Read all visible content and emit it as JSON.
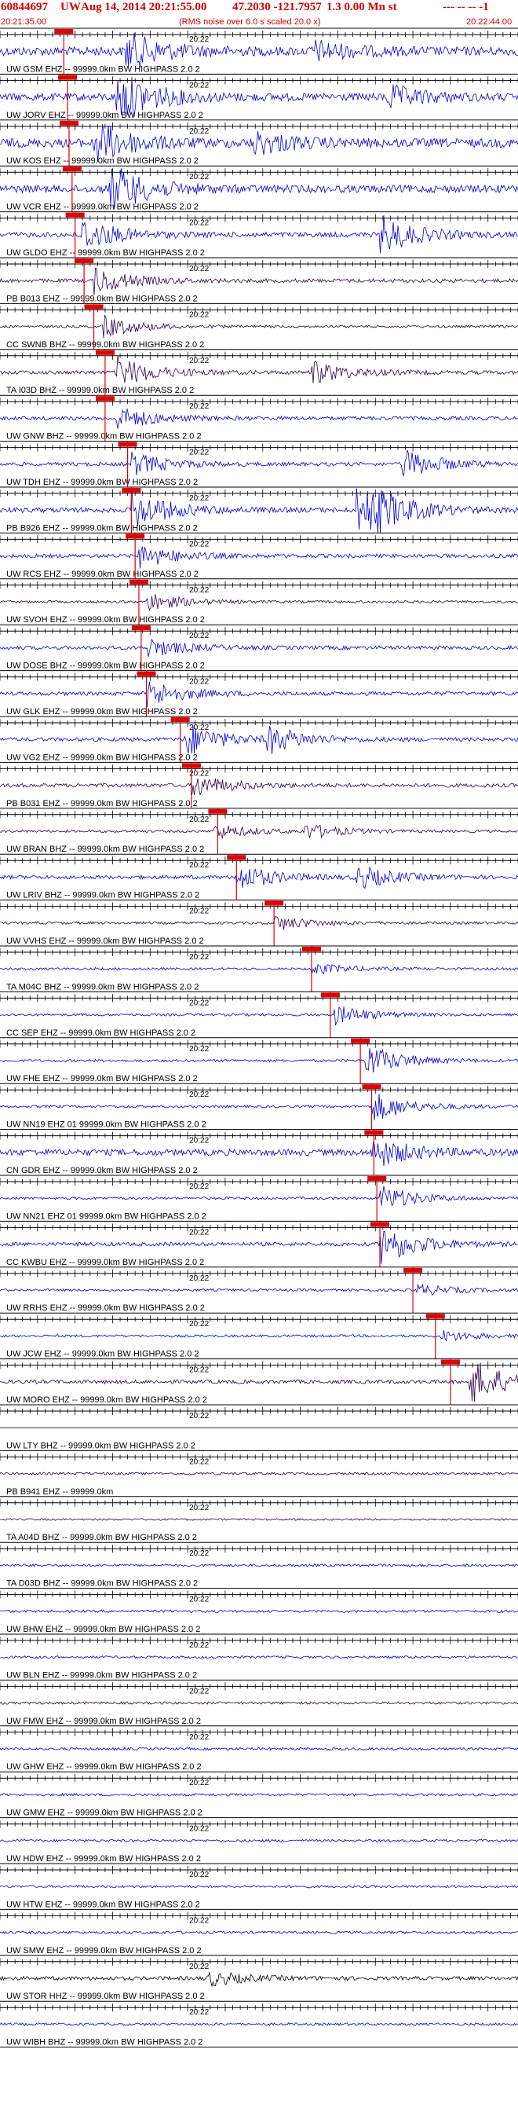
{
  "header": {
    "event_id": "60844697",
    "network": "UW",
    "datetime": "Aug 14, 2014 20:21:55.00",
    "location": "47.2030 -121.7957",
    "magnitude": "1.3 0.00 Mn st",
    "suffix": "--- -- -- -1",
    "start_time": "20:21:35.00",
    "noise_note": "(RMS noise over 6.0 s scaled 20.0 x)",
    "end_time": "20:22:44.00"
  },
  "colors": {
    "header_red": "#d10000",
    "trace_blue": "#0000d8",
    "trace_dark": "#2a0050",
    "trace_black": "#000000",
    "pick_red": "#e00000",
    "axis_black": "#000000"
  },
  "chart_data": {
    "type": "seismogram record section",
    "start_time": "20:21:35.00",
    "end_time": "20:22:44.00",
    "minute_tick_label": "20:22",
    "stations": [
      {
        "label": "UW GSM EHZ -- 99999.0km BW HIGHPASS 2.0 2",
        "pick_s": 8.5,
        "color": "blue",
        "amp": 0.7,
        "events": [
          {
            "t": 17,
            "a": 1.0
          },
          {
            "t": 42,
            "a": 0.5
          }
        ]
      },
      {
        "label": "UW JORV EHZ -- 99999.0km BW HIGHPASS 2.0 2",
        "pick_s": 9.0,
        "color": "blue",
        "amp": 0.6,
        "events": [
          {
            "t": 16,
            "a": 1.4
          },
          {
            "t": 52,
            "a": 0.6
          }
        ]
      },
      {
        "label": "UW KOS EHZ -- 99999.0km BW HIGHPASS 2.0 2",
        "pick_s": 9.2,
        "color": "blue",
        "amp": 0.7,
        "events": [
          {
            "t": 13,
            "a": 1.1
          },
          {
            "t": 34,
            "a": 0.6
          }
        ]
      },
      {
        "label": "UW VCR EHZ -- 99999.0km BW HIGHPASS 2.0 2",
        "pick_s": 9.6,
        "color": "blue",
        "amp": 0.6,
        "events": [
          {
            "t": 15,
            "a": 1.3
          }
        ]
      },
      {
        "label": "UW GLDO EHZ -- 99999.0km BW HIGHPASS 2.0 2",
        "pick_s": 10.0,
        "color": "blue",
        "amp": 0.4,
        "events": [
          {
            "t": 11,
            "a": 0.9
          },
          {
            "t": 51,
            "a": 1.0
          }
        ]
      },
      {
        "label": "PB B013 EHZ -- 99999.0km BW HIGHPASS 2.0 2",
        "pick_s": 11.2,
        "color": "dark",
        "amp": 0.3,
        "events": [
          {
            "t": 13,
            "a": 0.7
          }
        ]
      },
      {
        "label": "CC SWNB BHZ -- 99999.0km BW HIGHPASS 2.0 2",
        "pick_s": 12.5,
        "color": "dark",
        "amp": 0.2,
        "events": [
          {
            "t": 14,
            "a": 0.6
          }
        ]
      },
      {
        "label": "TA I03D BHZ -- 99999.0km BW HIGHPASS 2.0 2",
        "pick_s": 14.0,
        "color": "dark",
        "amp": 0.3,
        "events": [
          {
            "t": 16,
            "a": 0.8
          },
          {
            "t": 42,
            "a": 0.6
          }
        ]
      },
      {
        "label": "UW GNW BHZ -- 99999.0km BW HIGHPASS 2.0 2",
        "pick_s": 14.0,
        "color": "blue",
        "amp": 0.3,
        "events": [
          {
            "t": 16,
            "a": 0.6
          }
        ]
      },
      {
        "label": "UW TDH EHZ -- 99999.0km BW HIGHPASS 2.0 2",
        "pick_s": 17.0,
        "color": "blue",
        "amp": 0.3,
        "events": [
          {
            "t": 18,
            "a": 0.6
          },
          {
            "t": 54,
            "a": 0.8
          }
        ]
      },
      {
        "label": "PB B926 EHZ -- 99999.0km BW HIGHPASS 2.0 2",
        "pick_s": 17.5,
        "color": "blue",
        "amp": 0.4,
        "events": [
          {
            "t": 18,
            "a": 1.0
          },
          {
            "t": 48,
            "a": 2.2
          }
        ]
      },
      {
        "label": "UW RCS EHZ -- 99999.0km BW HIGHPASS 2.0 2",
        "pick_s": 18.0,
        "color": "blue",
        "amp": 0.3,
        "events": [
          {
            "t": 19,
            "a": 0.6
          }
        ]
      },
      {
        "label": "UW SVOH EHZ -- 99999.0km BW HIGHPASS 2.0 2",
        "pick_s": 18.5,
        "color": "dark",
        "amp": 0.2,
        "events": [
          {
            "t": 20,
            "a": 0.5
          }
        ]
      },
      {
        "label": "UW DOSE BHZ -- 99999.0km BW HIGHPASS 2.0 2",
        "pick_s": 18.8,
        "color": "blue",
        "amp": 0.3,
        "events": [
          {
            "t": 20,
            "a": 0.5
          }
        ]
      },
      {
        "label": "UW GLK EHZ -- 99999.0km BW HIGHPASS 2.0 2",
        "pick_s": 19.5,
        "color": "blue",
        "amp": 0.3,
        "events": [
          {
            "t": 20,
            "a": 0.7
          }
        ]
      },
      {
        "label": "UW VG2 EHZ -- 99999.0km BW HIGHPASS 2.0 2",
        "pick_s": 24.0,
        "color": "blue",
        "amp": 0.3,
        "events": [
          {
            "t": 25,
            "a": 0.9
          },
          {
            "t": 36,
            "a": 0.7
          }
        ]
      },
      {
        "label": "PB B031 EHZ -- 99999.0km BW HIGHPASS 2.0 2",
        "pick_s": 25.5,
        "color": "dark",
        "amp": 0.3,
        "events": [
          {
            "t": 26,
            "a": 0.6
          }
        ]
      },
      {
        "label": "UW BRAN BHZ -- 99999.0km BW HIGHPASS 2.0 2",
        "pick_s": 29.0,
        "color": "dark",
        "amp": 0.2,
        "events": [
          {
            "t": 29,
            "a": 0.4
          },
          {
            "t": 41,
            "a": 0.4
          }
        ]
      },
      {
        "label": "UW LRIV BHZ -- 99999.0km BW HIGHPASS 2.0 2",
        "pick_s": 31.5,
        "color": "blue",
        "amp": 0.3,
        "events": [
          {
            "t": 32,
            "a": 0.7
          },
          {
            "t": 48,
            "a": 0.6
          }
        ]
      },
      {
        "label": "UW VVHS EHZ -- 99999.0km BW HIGHPASS 2.0 2",
        "pick_s": 36.5,
        "color": "dark",
        "amp": 0.2,
        "events": [
          {
            "t": 37,
            "a": 0.4
          }
        ]
      },
      {
        "label": "TA M04C BHZ -- 99999.0km BW HIGHPASS 2.0 2",
        "pick_s": 41.5,
        "color": "blue",
        "amp": 0.2,
        "events": [
          {
            "t": 42,
            "a": 0.3
          }
        ]
      },
      {
        "label": "CC SEP EHZ -- 99999.0km BW HIGHPASS 2.0 2",
        "pick_s": 44.0,
        "color": "blue",
        "amp": 0.2,
        "events": [
          {
            "t": 45,
            "a": 0.5
          }
        ]
      },
      {
        "label": "UW FHE EHZ -- 99999.0km BW HIGHPASS 2.0 2",
        "pick_s": 48.0,
        "color": "blue",
        "amp": 0.2,
        "events": [
          {
            "t": 49,
            "a": 0.9
          }
        ]
      },
      {
        "label": "UW NN19 EHZ 01 99999.0km BW HIGHPASS 2.0 2",
        "pick_s": 49.5,
        "color": "blue",
        "amp": 0.2,
        "events": [
          {
            "t": 50,
            "a": 0.8
          }
        ]
      },
      {
        "label": "CN GDR EHZ -- 99999.0km BW HIGHPASS 2.0 2",
        "pick_s": 49.8,
        "color": "blue",
        "amp": 0.5,
        "events": [
          {
            "t": 50,
            "a": 0.8
          }
        ]
      },
      {
        "label": "UW NN21 EHZ 01 99999.0km BW HIGHPASS 2.0 2",
        "pick_s": 50.2,
        "color": "blue",
        "amp": 0.2,
        "events": [
          {
            "t": 51,
            "a": 0.7
          }
        ]
      },
      {
        "label": "CC KWBU EHZ -- 99999.0km BW HIGHPASS 2.0 2",
        "pick_s": 50.6,
        "color": "blue",
        "amp": 0.3,
        "events": [
          {
            "t": 51,
            "a": 1.1
          }
        ]
      },
      {
        "label": "UW RRHS EHZ -- 99999.0km BW HIGHPASS 2.0 2",
        "pick_s": 55.0,
        "color": "blue",
        "amp": 0.2,
        "events": [
          {
            "t": 56,
            "a": 0.3
          }
        ]
      },
      {
        "label": "UW JCW EHZ -- 99999.0km BW HIGHPASS 2.0 2",
        "pick_s": 58.0,
        "color": "blue",
        "amp": 0.2,
        "events": [
          {
            "t": 59,
            "a": 0.3
          }
        ]
      },
      {
        "label": "UW MORO EHZ -- 99999.0km BW HIGHPASS 2.0 2",
        "pick_s": 60.0,
        "color": "dark",
        "amp": 0.3,
        "events": [
          {
            "t": 63,
            "a": 1.2
          }
        ]
      },
      {
        "label": "UW LTY BHZ -- 99999.0km BW HIGHPASS 2.0 2",
        "pick_s": null,
        "color": "dark",
        "amp": 0.0,
        "events": []
      },
      {
        "label": "PB B941 EHZ -- 99999.0km",
        "pick_s": null,
        "color": "dark",
        "amp": 0.2,
        "events": []
      },
      {
        "label": "TA A04D BHZ -- 99999.0km BW HIGHPASS 2.0 2",
        "pick_s": null,
        "color": "dark",
        "amp": 0.15,
        "events": []
      },
      {
        "label": "TA D03D BHZ -- 99999.0km BW HIGHPASS 2.0 2",
        "pick_s": null,
        "color": "blue",
        "amp": 0.2,
        "events": []
      },
      {
        "label": "UW BHW EHZ -- 99999.0km BW HIGHPASS 2.0 2",
        "pick_s": null,
        "color": "blue",
        "amp": 0.2,
        "events": []
      },
      {
        "label": "UW BLN EHZ -- 99999.0km BW HIGHPASS 2.0 2",
        "pick_s": null,
        "color": "blue",
        "amp": 0.2,
        "events": []
      },
      {
        "label": "UW FMW EHZ -- 99999.0km BW HIGHPASS 2.0 2",
        "pick_s": null,
        "color": "dark",
        "amp": 0.2,
        "events": []
      },
      {
        "label": "UW GHW EHZ -- 99999.0km BW HIGHPASS 2.0 2",
        "pick_s": null,
        "color": "blue",
        "amp": 0.2,
        "events": []
      },
      {
        "label": "UW GMW EHZ -- 99999.0km BW HIGHPASS 2.0 2",
        "pick_s": null,
        "color": "blue",
        "amp": 0.2,
        "events": []
      },
      {
        "label": "UW HDW EHZ -- 99999.0km BW HIGHPASS 2.0 2",
        "pick_s": null,
        "color": "blue",
        "amp": 0.2,
        "events": []
      },
      {
        "label": "UW HTW EHZ -- 99999.0km BW HIGHPASS 2.0 2",
        "pick_s": null,
        "color": "blue",
        "amp": 0.2,
        "events": []
      },
      {
        "label": "UW SMW EHZ -- 99999.0km BW HIGHPASS 2.0 2",
        "pick_s": null,
        "color": "blue",
        "amp": 0.2,
        "events": []
      },
      {
        "label": "UW STOR HHZ -- 99999.0km BW HIGHPASS 2.0 2",
        "pick_s": null,
        "color": "black",
        "amp": 0.3,
        "events": [
          {
            "t": 28,
            "a": 0.4
          }
        ]
      },
      {
        "label": "UW WIBH BHZ -- 99999.0km BW HIGHPASS 2.0 2",
        "pick_s": null,
        "color": "blue",
        "amp": 0.2,
        "events": []
      }
    ]
  }
}
